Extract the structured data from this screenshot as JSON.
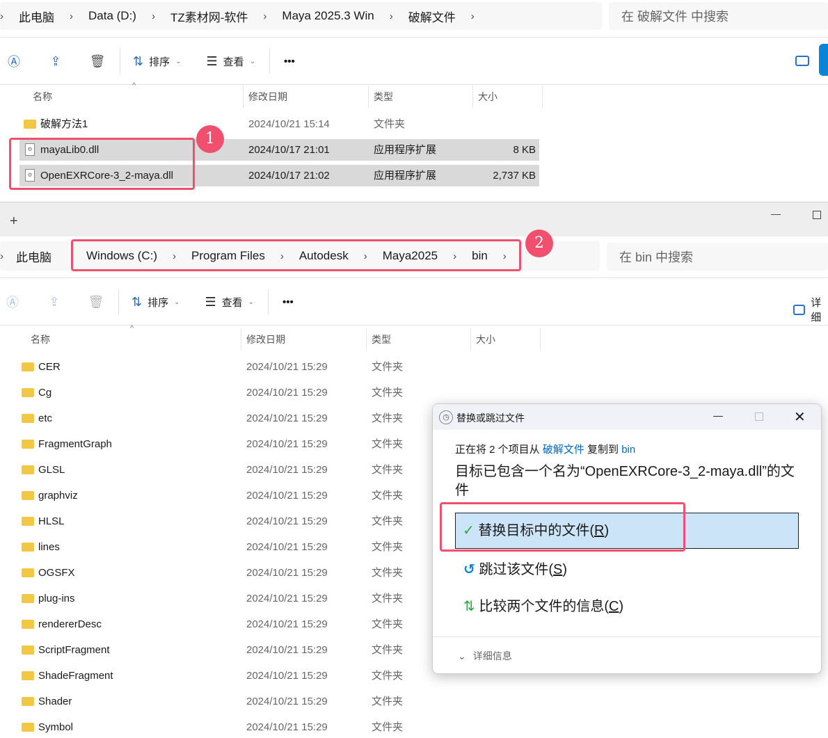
{
  "top_window": {
    "breadcrumb": [
      "此电脑",
      "Data (D:)",
      "TZ素材网-软件",
      "Maya 2025.3 Win",
      "破解文件"
    ],
    "search_placeholder": "在 破解文件 中搜索",
    "toolbar": {
      "sort": "排序",
      "view": "查看",
      "more": "•••"
    },
    "columns": [
      "名称",
      "修改日期",
      "类型",
      "大小"
    ],
    "rows": [
      {
        "name": "破解方法1",
        "date": "2024/10/21 15:14",
        "type": "文件夹",
        "size": ""
      },
      {
        "name": "mayaLib0.dll",
        "date": "2024/10/17 21:01",
        "type": "应用程序扩展",
        "size": "8 KB"
      },
      {
        "name": "OpenEXRCore-3_2-maya.dll",
        "date": "2024/10/17 21:02",
        "type": "应用程序扩展",
        "size": "2,737 KB"
      }
    ]
  },
  "bottom_window": {
    "new_tab": "+",
    "root": "此电脑",
    "breadcrumb": [
      "Windows (C:)",
      "Program Files",
      "Autodesk",
      "Maya2025",
      "bin"
    ],
    "search_placeholder": "在 bin 中搜索",
    "toolbar": {
      "sort": "排序",
      "view": "查看",
      "more": "•••",
      "details": "详细"
    },
    "columns": [
      "名称",
      "修改日期",
      "类型",
      "大小"
    ],
    "rows": [
      {
        "name": "CER",
        "date": "2024/10/21 15:29",
        "type": "文件夹"
      },
      {
        "name": "Cg",
        "date": "2024/10/21 15:29",
        "type": "文件夹"
      },
      {
        "name": "etc",
        "date": "2024/10/21 15:29",
        "type": "文件夹"
      },
      {
        "name": "FragmentGraph",
        "date": "2024/10/21 15:29",
        "type": "文件夹"
      },
      {
        "name": "GLSL",
        "date": "2024/10/21 15:29",
        "type": "文件夹"
      },
      {
        "name": "graphviz",
        "date": "2024/10/21 15:29",
        "type": "文件夹"
      },
      {
        "name": "HLSL",
        "date": "2024/10/21 15:29",
        "type": "文件夹"
      },
      {
        "name": "lines",
        "date": "2024/10/21 15:29",
        "type": "文件夹"
      },
      {
        "name": "OGSFX",
        "date": "2024/10/21 15:29",
        "type": "文件夹"
      },
      {
        "name": "plug-ins",
        "date": "2024/10/21 15:29",
        "type": "文件夹"
      },
      {
        "name": "rendererDesc",
        "date": "2024/10/21 15:29",
        "type": "文件夹"
      },
      {
        "name": "ScriptFragment",
        "date": "2024/10/21 15:29",
        "type": "文件夹"
      },
      {
        "name": "ShadeFragment",
        "date": "2024/10/21 15:29",
        "type": "文件夹"
      },
      {
        "name": "Shader",
        "date": "2024/10/21 15:29",
        "type": "文件夹"
      },
      {
        "name": "Symbol",
        "date": "2024/10/21 15:29",
        "type": "文件夹"
      }
    ]
  },
  "dialog": {
    "title": "替换或跳过文件",
    "copy_prefix": "正在将 2 个项目从 ",
    "source": "破解文件",
    "copy_mid": " 复制到 ",
    "dest": "bin",
    "message": "目标已包含一个名为“OpenEXRCore-3_2-maya.dll”的文件",
    "replace": "替换目标中的文件(",
    "replace_key": "R",
    "skip": "跳过该文件(",
    "skip_key": "S",
    "compare": "比较两个文件的信息(",
    "compare_key": "C",
    "close_paren": ")",
    "details": "详细信息"
  },
  "annotations": [
    "1",
    "2"
  ],
  "colors": {
    "accent": "#0067c0",
    "highlight": "#cce4f7",
    "annotation": "#f0506e"
  }
}
